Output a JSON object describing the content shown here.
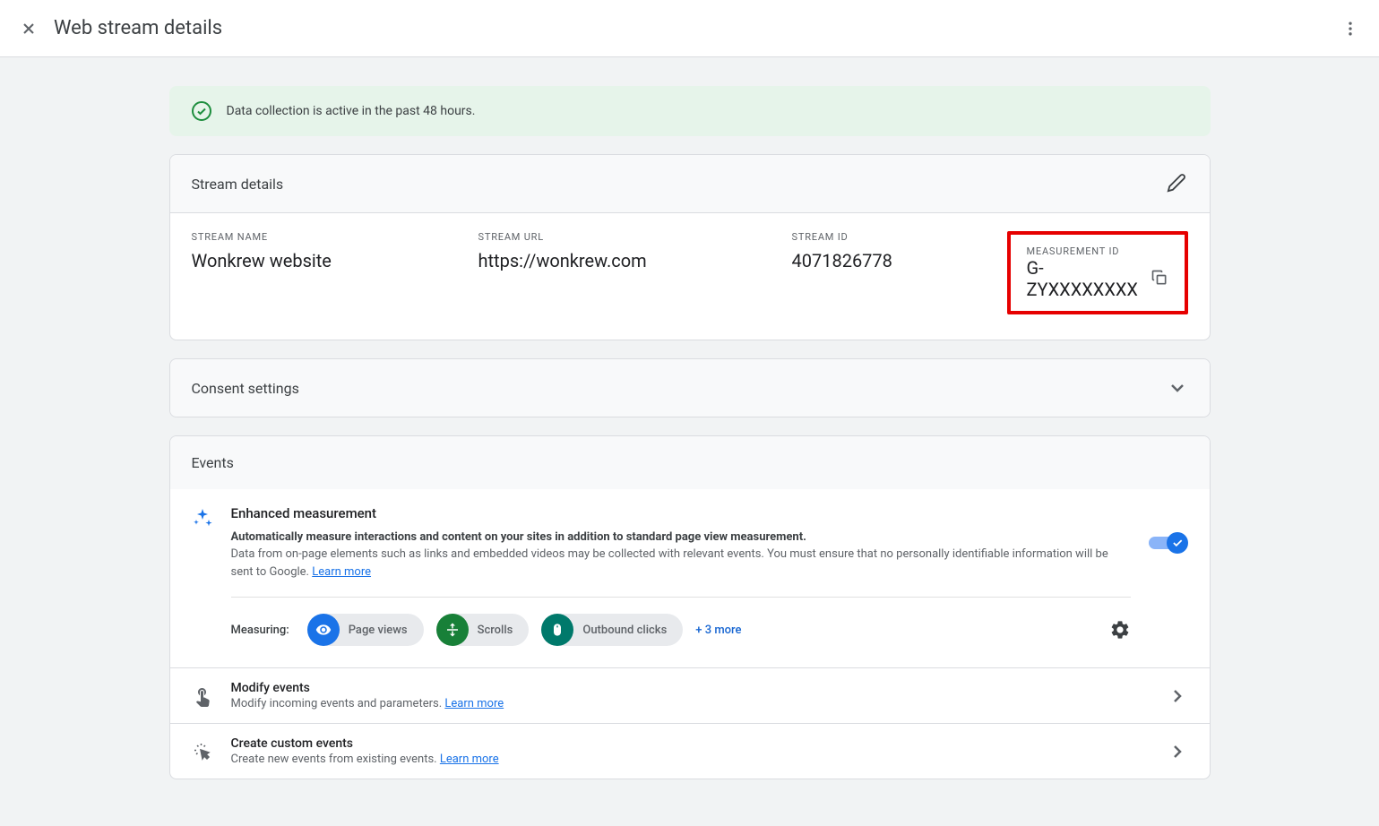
{
  "header": {
    "title": "Web stream details"
  },
  "banner": {
    "text": "Data collection is active in the past 48 hours."
  },
  "streamDetails": {
    "title": "Stream details",
    "columns": {
      "name": {
        "label": "STREAM NAME",
        "value": "Wonkrew website"
      },
      "url": {
        "label": "STREAM URL",
        "value": "https://wonkrew.com"
      },
      "id": {
        "label": "STREAM ID",
        "value": "4071826778"
      },
      "measurement": {
        "label": "MEASUREMENT ID",
        "value": "G-ZYXXXXXXXX"
      }
    }
  },
  "consent": {
    "title": "Consent settings"
  },
  "events": {
    "title": "Events",
    "enhanced": {
      "title": "Enhanced measurement",
      "subtitle": "Automatically measure interactions and content on your sites in addition to standard page view measurement.",
      "description": "Data from on-page elements such as links and embedded videos may be collected with relevant events. You must ensure that no personally identifiable information will be sent to Google.",
      "learnMore": "Learn more"
    },
    "measuring": {
      "label": "Measuring:",
      "chips": [
        {
          "name": "Page views"
        },
        {
          "name": "Scrolls"
        },
        {
          "name": "Outbound clicks"
        }
      ],
      "more": "+ 3 more"
    },
    "modify": {
      "title": "Modify events",
      "desc": "Modify incoming events and parameters. ",
      "learnMore": "Learn more"
    },
    "custom": {
      "title": "Create custom events",
      "desc": "Create new events from existing events. ",
      "learnMore": "Learn more"
    }
  }
}
